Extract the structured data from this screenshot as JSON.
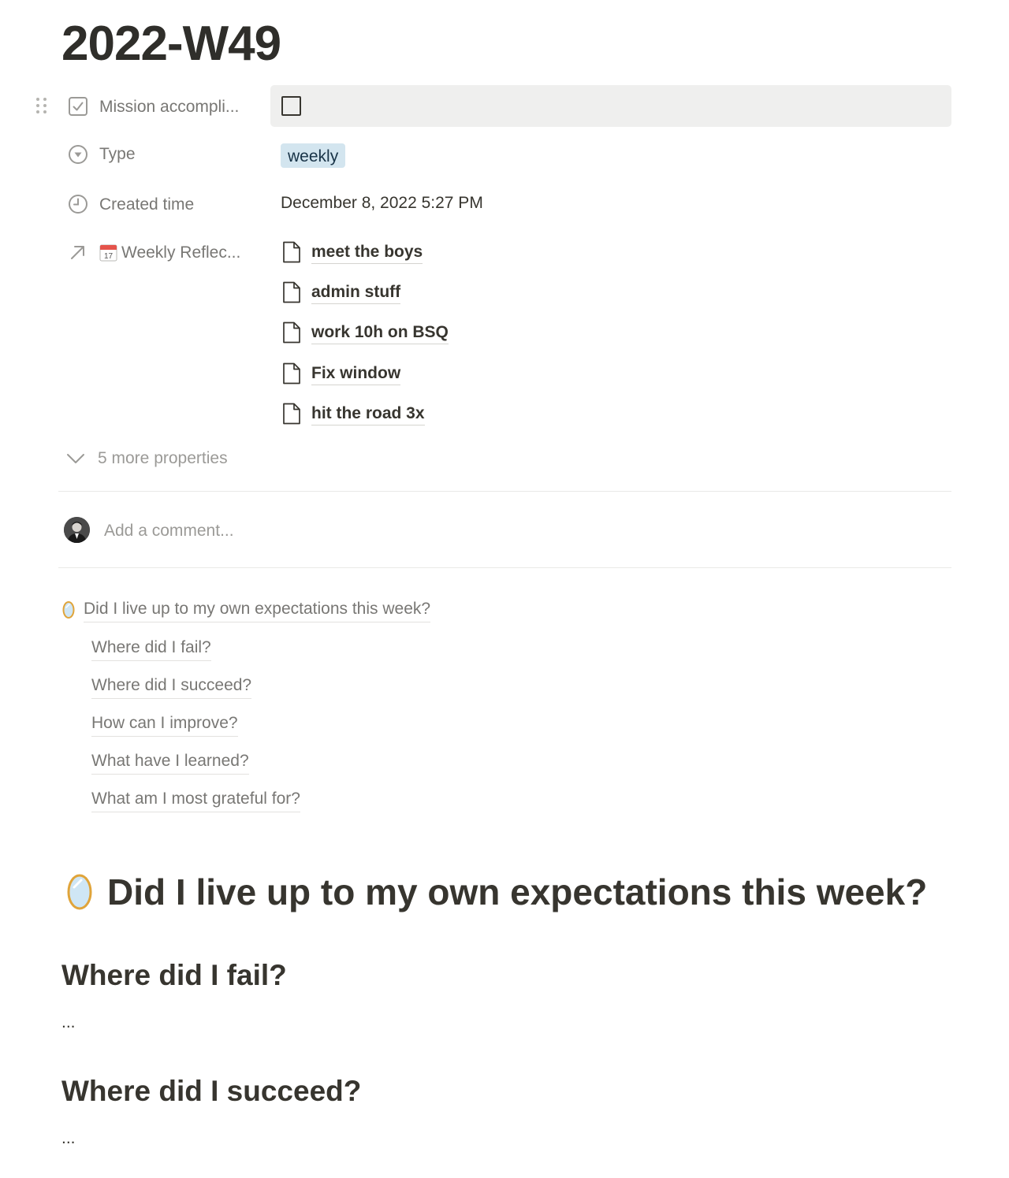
{
  "page": {
    "title": "2022-W49"
  },
  "properties": {
    "mission": {
      "label": "Mission accompli...",
      "icon": "checkbox-property-icon",
      "checked": false
    },
    "type": {
      "label": "Type",
      "icon": "select-property-icon",
      "value": "weekly",
      "tag_color": "#d3e5ef"
    },
    "created_time": {
      "label": "Created time",
      "icon": "clock-icon",
      "value": "December 8, 2022 5:27 PM"
    },
    "weekly_reflection": {
      "label": "Weekly Reflec...",
      "icon": "relation-arrow-icon",
      "emoji_icon": "calendar-icon",
      "items": [
        "meet the boys",
        "admin stuff",
        "work 10h on BSQ",
        "Fix window",
        "hit the road 3x"
      ]
    },
    "more": {
      "label": "5 more properties",
      "icon": "chevron-down-icon"
    }
  },
  "comment": {
    "placeholder": "Add a comment..."
  },
  "toc": {
    "main": "Did I live up to my own expectations this week?",
    "items": [
      "Where did I fail?",
      "Where did I succeed?",
      "How can I improve?",
      "What have I learned?",
      "What am I most grateful for?"
    ]
  },
  "content": {
    "heading1": "Did I live up to my own expectations this week?",
    "sections": [
      {
        "heading": "Where did I fail?",
        "text": "..."
      },
      {
        "heading": "Where did I succeed?",
        "text": "..."
      }
    ]
  }
}
